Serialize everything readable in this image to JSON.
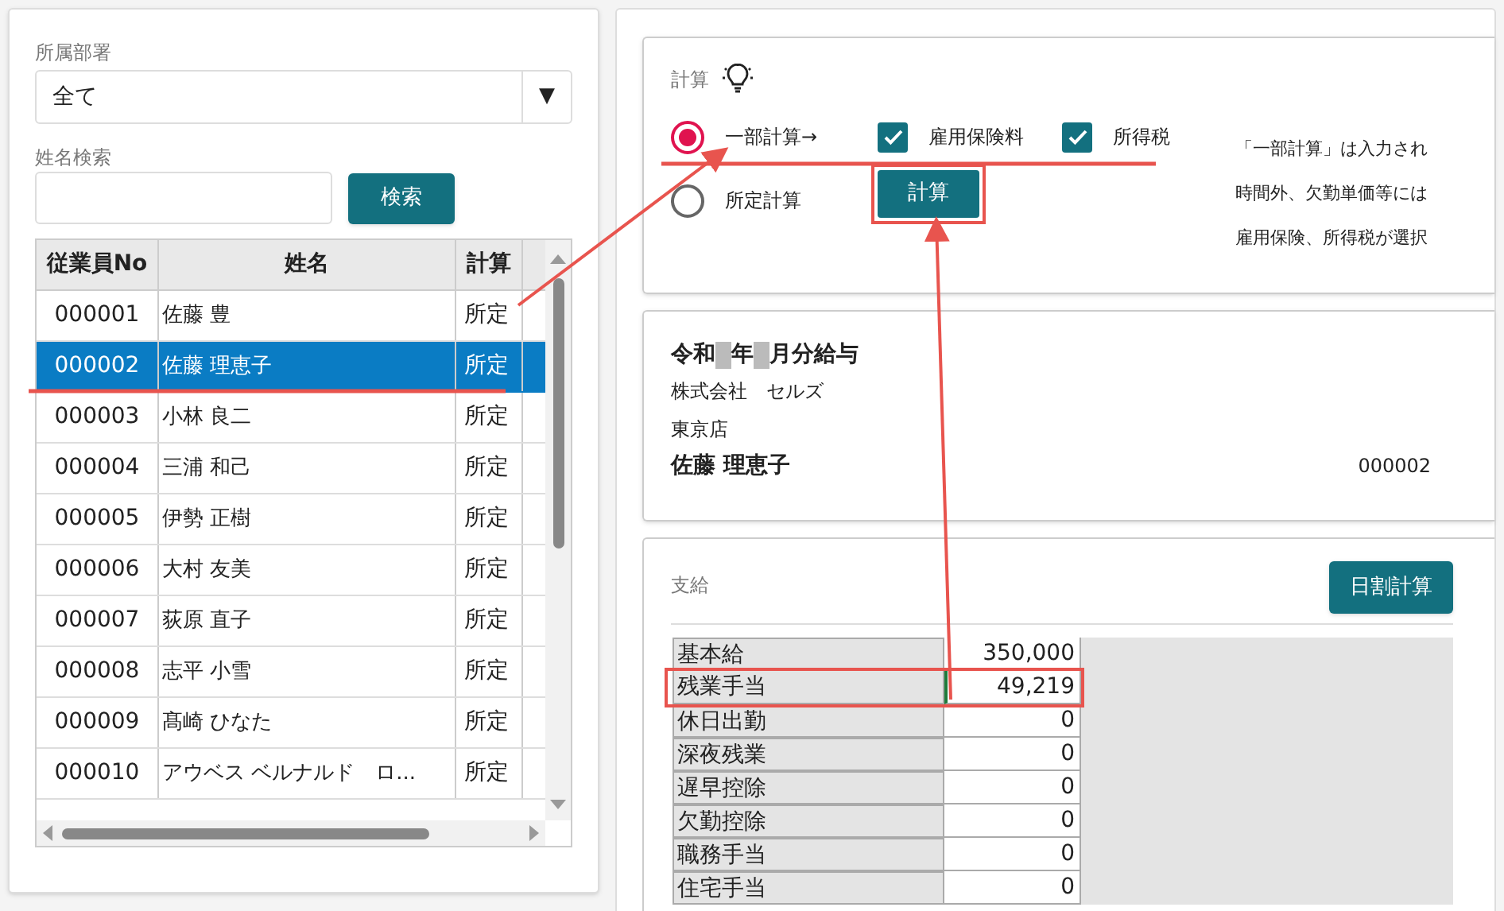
{
  "filters": {
    "department_label": "所属部署",
    "department_value": "全て",
    "dropdown_glyph": "▼",
    "name_search_label": "姓名検索",
    "search_button": "検索"
  },
  "employee_table": {
    "columns": [
      "従業員No",
      "姓名",
      "計算"
    ],
    "rows": [
      {
        "no": "000001",
        "name": "佐藤 豊",
        "calc": "所定",
        "selected": false
      },
      {
        "no": "000002",
        "name": "佐藤 理恵子",
        "calc": "所定",
        "selected": true
      },
      {
        "no": "000003",
        "name": "小林 良二",
        "calc": "所定",
        "selected": false
      },
      {
        "no": "000004",
        "name": "三浦 和己",
        "calc": "所定",
        "selected": false
      },
      {
        "no": "000005",
        "name": "伊勢 正樹",
        "calc": "所定",
        "selected": false
      },
      {
        "no": "000006",
        "name": "大村 友美",
        "calc": "所定",
        "selected": false
      },
      {
        "no": "000007",
        "name": "荻原 直子",
        "calc": "所定",
        "selected": false
      },
      {
        "no": "000008",
        "name": "志平 小雪",
        "calc": "所定",
        "selected": false
      },
      {
        "no": "000009",
        "name": "髙崎 ひなた",
        "calc": "所定",
        "selected": false
      },
      {
        "no": "000010",
        "name": "アウベス ベルナルド　ロ...",
        "calc": "所定",
        "selected": false
      }
    ]
  },
  "calculation": {
    "title": "計算",
    "options": [
      {
        "label": "一部計算→",
        "selected": true
      },
      {
        "label": "所定計算",
        "selected": false
      }
    ],
    "checks": [
      {
        "label": "雇用保険料",
        "checked": true
      },
      {
        "label": "所得税",
        "checked": true
      }
    ],
    "button": "計算",
    "notes": [
      "「一部計算」は入力され",
      "時間外、欠勤単価等には",
      "雇用保険、所得税が選択"
    ]
  },
  "payslip": {
    "title_segments": [
      "令和",
      "年",
      "月分給与"
    ],
    "company": "株式会社　セルズ",
    "branch": "東京店",
    "employee_name": "佐藤 理恵子",
    "employee_no": "000002"
  },
  "payments": {
    "title": "支給",
    "button": "日割計算",
    "rows": [
      {
        "label": "基本給",
        "value": "350,000",
        "highlighted": false
      },
      {
        "label": "残業手当",
        "value": "49,219",
        "highlighted": true
      },
      {
        "label": "休日出勤",
        "value": "0",
        "highlighted": false
      },
      {
        "label": "深夜残業",
        "value": "0",
        "highlighted": false
      },
      {
        "label": "遅早控除",
        "value": "0",
        "highlighted": false
      },
      {
        "label": "欠勤控除",
        "value": "0",
        "highlighted": false
      },
      {
        "label": "職務手当",
        "value": "0",
        "highlighted": false
      },
      {
        "label": "住宅手当",
        "value": "0",
        "highlighted": false
      }
    ]
  }
}
